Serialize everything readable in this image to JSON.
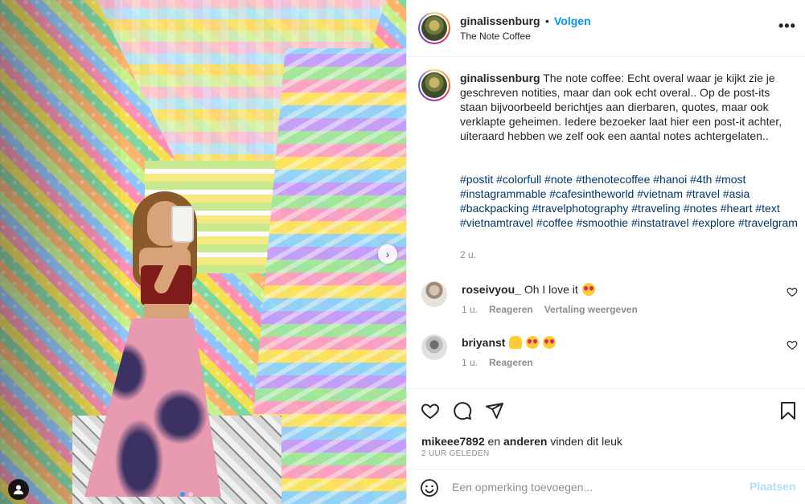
{
  "post": {
    "username": "ginalissenburg",
    "follow_label": "Volgen",
    "dot": "•",
    "location": "The Note Coffee",
    "more_label": "•••"
  },
  "caption": {
    "username": "ginalissenburg",
    "text": "The note coffee: Echt overal waar je kijkt zie je geschreven notities, maar dan ook echt overal.. Op de post-its staan bijvoorbeeld berichtjes aan dierbaren, quotes, maar ook verklapte geheimen. Iedere bezoeker laat hier een post-it achter, uiteraard hebben we zelf ook een aantal notes achtergelaten..",
    "hashtags": "#postit #colorfull #note #thenotecoffee #hanoi #4th #most #instagrammable #cafesintheworld #vietnam #travel #asia #backpacking #travelphotography #traveling #notes #heart #text #vietnamtravel #coffee #smoothie #instatravel #explore #travelgram",
    "time": "2 u."
  },
  "comments": [
    {
      "username": "roseivyou_",
      "text": "Oh I love it",
      "time": "1 u.",
      "reply_label": "Reageren",
      "translate_label": "Vertaling weergeven"
    },
    {
      "username": "briyanst",
      "text": "",
      "time": "1 u.",
      "reply_label": "Reageren"
    }
  ],
  "likes": {
    "user": "mikeee7892",
    "connector": "en",
    "others": "anderen",
    "suffix": "vinden dit leuk",
    "ago": "2 UUR GELEDEN"
  },
  "add_comment": {
    "placeholder": "Een opmerking toevoegen...",
    "post_label": "Plaatsen"
  },
  "carousel": {
    "total": 2,
    "active": 1
  },
  "colors": {
    "link": "#0095f6",
    "hashtag": "#00376b",
    "muted": "#8e8e8e",
    "post_disabled": "#b2dffc"
  }
}
